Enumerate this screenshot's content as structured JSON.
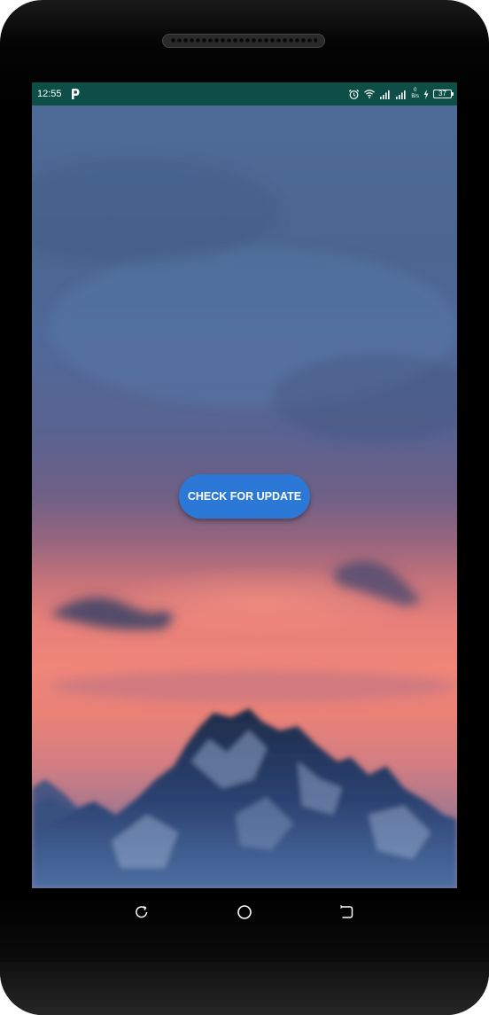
{
  "status_bar": {
    "time": "12:55",
    "app_icon": "p-icon",
    "icons": [
      "alarm-icon",
      "wifi-icon",
      "signal-icon",
      "signal-icon",
      "netspeed-icon",
      "charging-icon",
      "battery-icon"
    ],
    "netspeed_value": "0",
    "netspeed_unit": "B/s",
    "battery_level": "37",
    "background_color": "#0d4f47"
  },
  "main": {
    "wallpaper": "blurred-sunset-mountains",
    "button_label": "CHECK FOR UPDATE",
    "button_color": "#2b78d6"
  },
  "navigation_bar": {
    "buttons": [
      "recents-icon",
      "home-icon",
      "back-icon"
    ]
  }
}
